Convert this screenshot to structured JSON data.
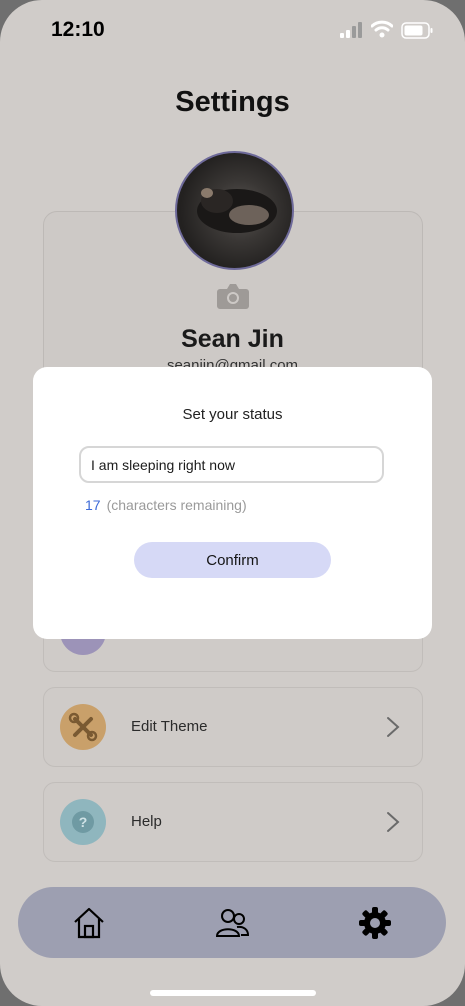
{
  "status_bar": {
    "time": "12:10"
  },
  "page": {
    "title": "Settings"
  },
  "profile": {
    "name": "Sean Jin",
    "email": "seanjin@gmail.com"
  },
  "menu": [
    {
      "label": "Edit Theme",
      "icon": "tools-icon",
      "color": "#c9a06a"
    },
    {
      "label": "Help",
      "icon": "question-icon",
      "color": "#8fb6be"
    }
  ],
  "tabs": [
    {
      "name": "home-icon"
    },
    {
      "name": "people-icon"
    },
    {
      "name": "gear-icon"
    }
  ],
  "modal": {
    "title": "Set your status",
    "input_value": "I am sleeping right now",
    "chars_remaining": "17",
    "chars_remaining_label": "(characters remaining)",
    "confirm_label": "Confirm"
  },
  "colors": {
    "accent": "#3c6ad8",
    "confirm_button": "#d6d9f6",
    "tab_bar": "#9d9fb1"
  }
}
